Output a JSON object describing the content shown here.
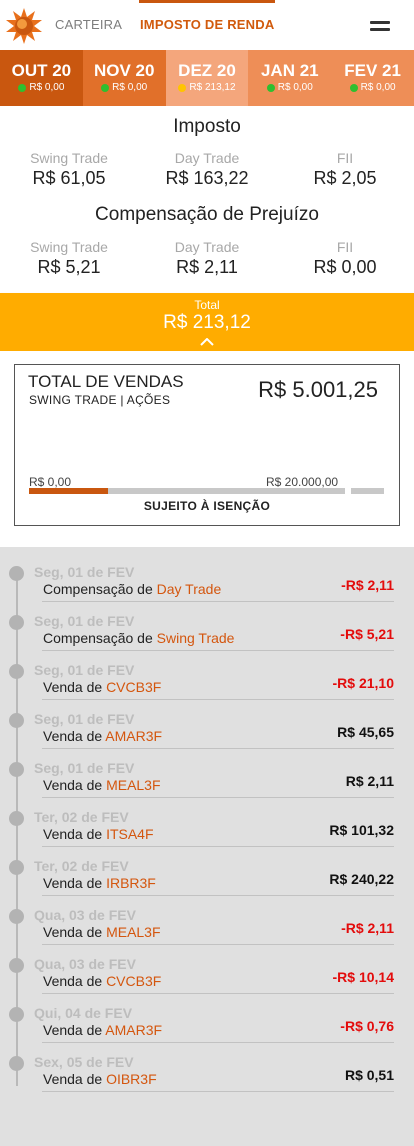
{
  "nav": {
    "tabs": [
      {
        "label": "CARTEIRA",
        "active": false
      },
      {
        "label": "IMPOSTO DE RENDA",
        "active": true
      }
    ],
    "accent": "#c9570f"
  },
  "months": [
    {
      "name": "OUT 20",
      "value": "R$ 0,00",
      "status": "green",
      "bg": "#c9570f"
    },
    {
      "name": "NOV 20",
      "value": "R$ 0,00",
      "status": "green",
      "bg": "#e1702a"
    },
    {
      "name": "DEZ 20",
      "value": "R$ 213,12",
      "status": "yellow",
      "bg": "#f4a67c"
    },
    {
      "name": "JAN 21",
      "value": "R$ 0,00",
      "status": "green",
      "bg": "#ee8e57"
    },
    {
      "name": "FEV 21",
      "value": "R$ 0,00",
      "status": "green",
      "bg": "#ee8e57"
    }
  ],
  "imposto": {
    "title": "Imposto",
    "items": [
      {
        "label": "Swing Trade",
        "value": "R$ 61,05"
      },
      {
        "label": "Day Trade",
        "value": "R$ 163,22"
      },
      {
        "label": "FII",
        "value": "R$ 2,05"
      }
    ]
  },
  "compensacao": {
    "title": "Compensação de Prejuízo",
    "items": [
      {
        "label": "Swing Trade",
        "value": "R$ 5,21"
      },
      {
        "label": "Day Trade",
        "value": "R$ 2,11"
      },
      {
        "label": "FII",
        "value": "R$ 0,00"
      }
    ]
  },
  "total": {
    "label": "Total",
    "value": "R$ 213,12",
    "color": "#ffac00"
  },
  "vendas": {
    "title": "TOTAL DE VENDAS",
    "subtitle": "SWING TRADE | AÇÕES",
    "value": "R$ 5.001,25",
    "scale_min": "R$ 0,00",
    "scale_max": "R$ 20.000,00",
    "progress_fraction": 0.25,
    "footer": "SUJEITO À ISENÇÃO"
  },
  "timeline": [
    {
      "date": "Seg, 01 de FEV",
      "prefix": "Compensação de",
      "ticker": "Day Trade",
      "amount": "-R$ 2,11",
      "negative": true
    },
    {
      "date": "Seg, 01 de FEV",
      "prefix": "Compensação de",
      "ticker": "Swing Trade",
      "amount": "-R$ 5,21",
      "negative": true
    },
    {
      "date": "Seg, 01 de FEV",
      "prefix": "Venda de",
      "ticker": "CVCB3F",
      "amount": "-R$ 21,10",
      "negative": true
    },
    {
      "date": "Seg, 01 de FEV",
      "prefix": "Venda de",
      "ticker": "AMAR3F",
      "amount": "R$ 45,65",
      "negative": false
    },
    {
      "date": "Seg, 01 de FEV",
      "prefix": "Venda de",
      "ticker": "MEAL3F",
      "amount": "R$ 2,11",
      "negative": false
    },
    {
      "date": "Ter, 02 de FEV",
      "prefix": "Venda de",
      "ticker": "ITSA4F",
      "amount": "R$ 101,32",
      "negative": false
    },
    {
      "date": "Ter, 02 de FEV",
      "prefix": "Venda de",
      "ticker": "IRBR3F",
      "amount": "R$ 240,22",
      "negative": false
    },
    {
      "date": "Qua, 03 de FEV",
      "prefix": "Venda de",
      "ticker": "MEAL3F",
      "amount": "-R$ 2,11",
      "negative": true
    },
    {
      "date": "Qua, 03 de FEV",
      "prefix": "Venda de",
      "ticker": "CVCB3F",
      "amount": "-R$ 10,14",
      "negative": true
    },
    {
      "date": "Qui, 04 de FEV",
      "prefix": "Venda de",
      "ticker": "AMAR3F",
      "amount": "-R$ 0,76",
      "negative": true
    },
    {
      "date": "Sex, 05 de FEV",
      "prefix": "Venda de",
      "ticker": "OIBR3F",
      "amount": "R$ 0,51",
      "negative": false
    }
  ]
}
